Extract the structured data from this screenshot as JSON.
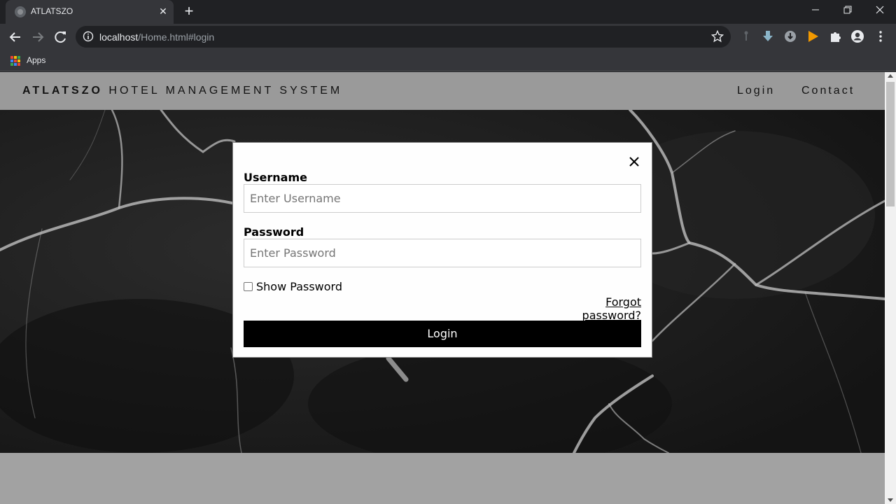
{
  "browser": {
    "tab_title": "ATLATSZO",
    "url_host": "localhost",
    "url_path": "/Home.html#login",
    "bookmarks_apps_label": "Apps",
    "apps_colors": [
      "#ea4335",
      "#fbbc05",
      "#34a853",
      "#4285f4",
      "#ea4335",
      "#fbbc05",
      "#34a853",
      "#4285f4",
      "#ea4335"
    ]
  },
  "site": {
    "brand_bold": "ATLATSZO",
    "brand_rest": " HOTEL MANAGEMENT SYSTEM",
    "nav": {
      "login": "Login",
      "contact": "Contact"
    }
  },
  "login_modal": {
    "username_label": "Username",
    "username_placeholder": "Enter Username",
    "password_label": "Password",
    "password_placeholder": "Enter Password",
    "show_password_label": "Show Password",
    "show_password_checked": false,
    "forgot_password": "Forgot password?",
    "login_button": "Login"
  },
  "colors": {
    "accent_extension": "#f29900",
    "nav_bg": "#9a9a9a",
    "button_bg": "#000000"
  }
}
